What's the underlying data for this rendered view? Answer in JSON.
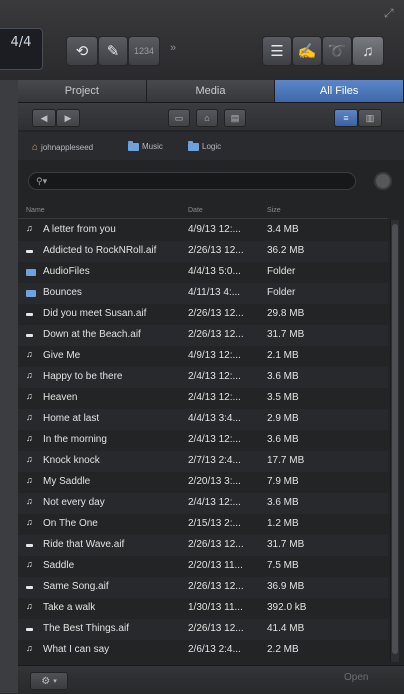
{
  "toolbar": {
    "signature_number": "4/4",
    "signature_sub": "",
    "count_in": "1234",
    "small_mark": "»"
  },
  "browser": {
    "tabs": [
      "Project",
      "Media",
      "All Files"
    ],
    "active_tab": "All Files",
    "breadcrumbs": [
      "johnappleseed",
      "Music",
      "Logic"
    ],
    "search_placeholder": "",
    "columns": {
      "name": "Name",
      "date": "Date",
      "size": "Size"
    },
    "files": [
      {
        "name": "A letter from you",
        "date": "4/9/13 12:...",
        "size": "3.4 MB",
        "icon": "music-icon"
      },
      {
        "name": "Addicted to RockNRoll.aif",
        "date": "2/26/13 12...",
        "size": "36.2 MB",
        "icon": "audio-file-icon"
      },
      {
        "name": "AudioFiles",
        "date": "4/4/13 5:0...",
        "size": "Folder",
        "icon": "folder-icon"
      },
      {
        "name": "Bounces",
        "date": "4/11/13 4:...",
        "size": "Folder",
        "icon": "folder-icon"
      },
      {
        "name": "Did you meet Susan.aif",
        "date": "2/26/13 12...",
        "size": "29.8 MB",
        "icon": "audio-file-icon"
      },
      {
        "name": "Down at the Beach.aif",
        "date": "2/26/13 12...",
        "size": "31.7 MB",
        "icon": "audio-file-icon"
      },
      {
        "name": "Give Me",
        "date": "4/9/13 12:...",
        "size": "2.1 MB",
        "icon": "music-icon"
      },
      {
        "name": "Happy to be there",
        "date": "2/4/13 12:...",
        "size": "3.6 MB",
        "icon": "music-icon"
      },
      {
        "name": "Heaven",
        "date": "2/4/13 12:...",
        "size": "3.5 MB",
        "icon": "music-icon"
      },
      {
        "name": "Home at last",
        "date": "4/4/13 3:4...",
        "size": "2.9 MB",
        "icon": "music-icon"
      },
      {
        "name": "In the morning",
        "date": "2/4/13 12:...",
        "size": "3.6 MB",
        "icon": "music-icon"
      },
      {
        "name": "Knock knock",
        "date": "2/7/13 2:4...",
        "size": "17.7 MB",
        "icon": "music-icon"
      },
      {
        "name": "My Saddle",
        "date": "2/20/13 3:...",
        "size": "7.9 MB",
        "icon": "music-icon"
      },
      {
        "name": "Not every day",
        "date": "2/4/13 12:...",
        "size": "3.6 MB",
        "icon": "music-icon"
      },
      {
        "name": "On The One",
        "date": "2/15/13 2:...",
        "size": "1.2 MB",
        "icon": "music-icon"
      },
      {
        "name": "Ride that Wave.aif",
        "date": "2/26/13 12...",
        "size": "31.7 MB",
        "icon": "audio-file-icon"
      },
      {
        "name": "Saddle",
        "date": "2/20/13 11...",
        "size": "7.5 MB",
        "icon": "music-icon"
      },
      {
        "name": "Same Song.aif",
        "date": "2/26/13 12...",
        "size": "36.9 MB",
        "icon": "audio-file-icon"
      },
      {
        "name": "Take a walk",
        "date": "1/30/13 11...",
        "size": "392.0 kB",
        "icon": "music-icon"
      },
      {
        "name": "The Best Things.aif",
        "date": "2/26/13 12...",
        "size": "41.4 MB",
        "icon": "audio-file-icon"
      },
      {
        "name": "What I can say",
        "date": "2/6/13 2:4...",
        "size": "2.2 MB",
        "icon": "music-icon"
      }
    ],
    "open_label": "Open"
  },
  "colors": {
    "accent_tab": "#4a74b8",
    "background": "#232426"
  }
}
